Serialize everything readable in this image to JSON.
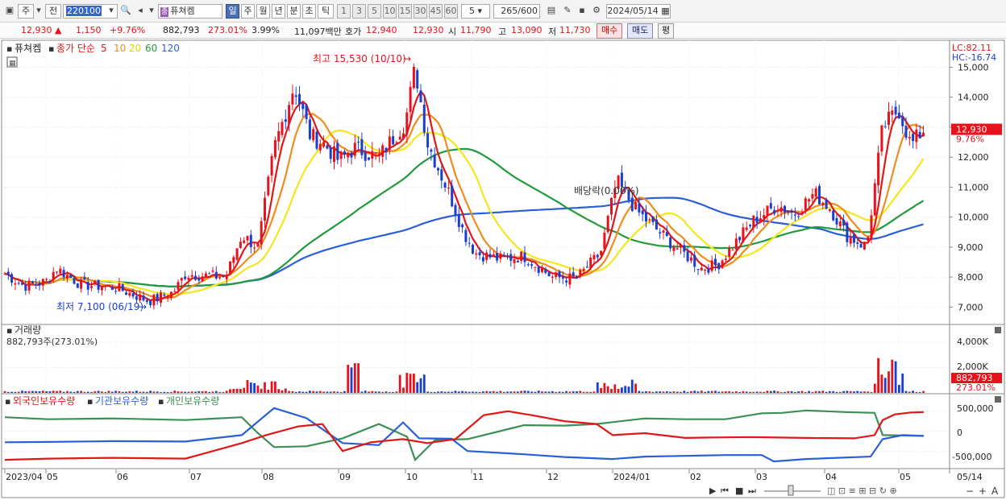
{
  "toolbar": {
    "market_btn": "주",
    "prev_btn": "전",
    "stock_code": "220100",
    "stock_name": "퓨쳐켐",
    "stock_badge": "종",
    "periods": [
      "일",
      "주",
      "월",
      "년",
      "분",
      "초",
      "틱"
    ],
    "active_period": "일",
    "minute_buttons": [
      "1",
      "3",
      "5",
      "10",
      "15",
      "30",
      "45",
      "60"
    ],
    "interval_value": "5",
    "count": "265",
    "count_max": "/600",
    "date": "2024/05/14"
  },
  "quote": {
    "price": "12,930",
    "change": "1,150",
    "change_pct": "+9.76%",
    "volume": "882,793",
    "volume_pct": "273.01%",
    "turnover_pct": "3.99%",
    "amount": "11,097백만",
    "bid_label": "호가",
    "ask": "12,940",
    "bid": "12,930",
    "open_label": "시",
    "open": "11,790",
    "high_label": "고",
    "high": "13,090",
    "low_label": "저",
    "low": "11,730",
    "buy_label": "매수",
    "sell_label": "매도",
    "even_label": "평"
  },
  "colors": {
    "up": "#e8121c",
    "down": "#1a3fd0",
    "ma5": "#e01818",
    "ma10": "#f08c1e",
    "ma20": "#f5e61e",
    "ma60": "#219a3c",
    "ma120": "#2a5fd8"
  },
  "chart_data": [
    {
      "type": "candlestick",
      "title": "퓨쳐켐",
      "legend": [
        {
          "name": "종가 단순",
          "color": "#e01818"
        },
        {
          "name": "5",
          "color": "#e01818"
        },
        {
          "name": "10",
          "color": "#f08c1e"
        },
        {
          "name": "20",
          "color": "#f5e61e"
        },
        {
          "name": "60",
          "color": "#219a3c"
        },
        {
          "name": "120",
          "color": "#2a5fd8"
        }
      ],
      "ylim": [
        6500,
        15900
      ],
      "yticks": [
        "15,000",
        "14,000",
        "13,000",
        "12,000",
        "11,000",
        "10,000",
        "9,000",
        "8,000",
        "7,000"
      ],
      "ytick_values": [
        15000,
        14000,
        13000,
        12000,
        11000,
        10000,
        9000,
        8000,
        7000
      ],
      "indicators_right": {
        "lc": "LC:82.11",
        "hc": "HC:-16.74"
      },
      "current_price_label": "12,930",
      "current_change_label": "9.76%",
      "current_price": 12930,
      "annotations": [
        {
          "text": "최고 15,530 (10/10)",
          "value": 15530,
          "date": "2023/10/10"
        },
        {
          "text": "최저 7,100 (06/19)",
          "value": 7100,
          "date": "2023/06/19"
        },
        {
          "text": "배당락(0.00%)",
          "date": "2023/12/27"
        }
      ],
      "months": [
        "2023/04",
        "05",
        "06",
        "07",
        "08",
        "09",
        "10",
        "11",
        "12",
        "2024/01",
        "02",
        "03",
        "04",
        "05"
      ],
      "month_end_label": "05/14",
      "closes_monthly_approx": [
        {
          "date": "2023/04",
          "close": 8100
        },
        {
          "date": "2023/05",
          "close": 7800
        },
        {
          "date": "2023/06",
          "close": 7500
        },
        {
          "date": "2023/07",
          "close": 7900
        },
        {
          "date": "2023/08",
          "close": 12400
        },
        {
          "date": "2023/09",
          "close": 11900
        },
        {
          "date": "2023/10",
          "close": 13200
        },
        {
          "date": "2023/11",
          "close": 8600
        },
        {
          "date": "2023/12",
          "close": 8100
        },
        {
          "date": "2024/01",
          "close": 10500
        },
        {
          "date": "2024/02",
          "close": 8300
        },
        {
          "date": "2024/03",
          "close": 10100
        },
        {
          "date": "2024/04",
          "close": 9200
        },
        {
          "date": "2024/05",
          "close": 12930
        }
      ]
    },
    {
      "type": "bar",
      "title": "거래량",
      "subtitle": "882,793주(273.01%)",
      "yticks": [
        "4,000K",
        "2,000K"
      ],
      "ytick_values": [
        4000000,
        2000000
      ],
      "last_value_label": "882,793",
      "last_pct_label": "273.01%",
      "last_value": 882793
    },
    {
      "type": "line",
      "series": [
        {
          "name": "외국인보유수량",
          "color": "#e01818"
        },
        {
          "name": "기관보유수량",
          "color": "#2a5fd8"
        },
        {
          "name": "개인보유수량",
          "color": "#3c8f55"
        }
      ],
      "yticks": [
        "500,000",
        "0",
        "-500,000"
      ],
      "ytick_values": [
        500000,
        0,
        -500000
      ]
    }
  ]
}
